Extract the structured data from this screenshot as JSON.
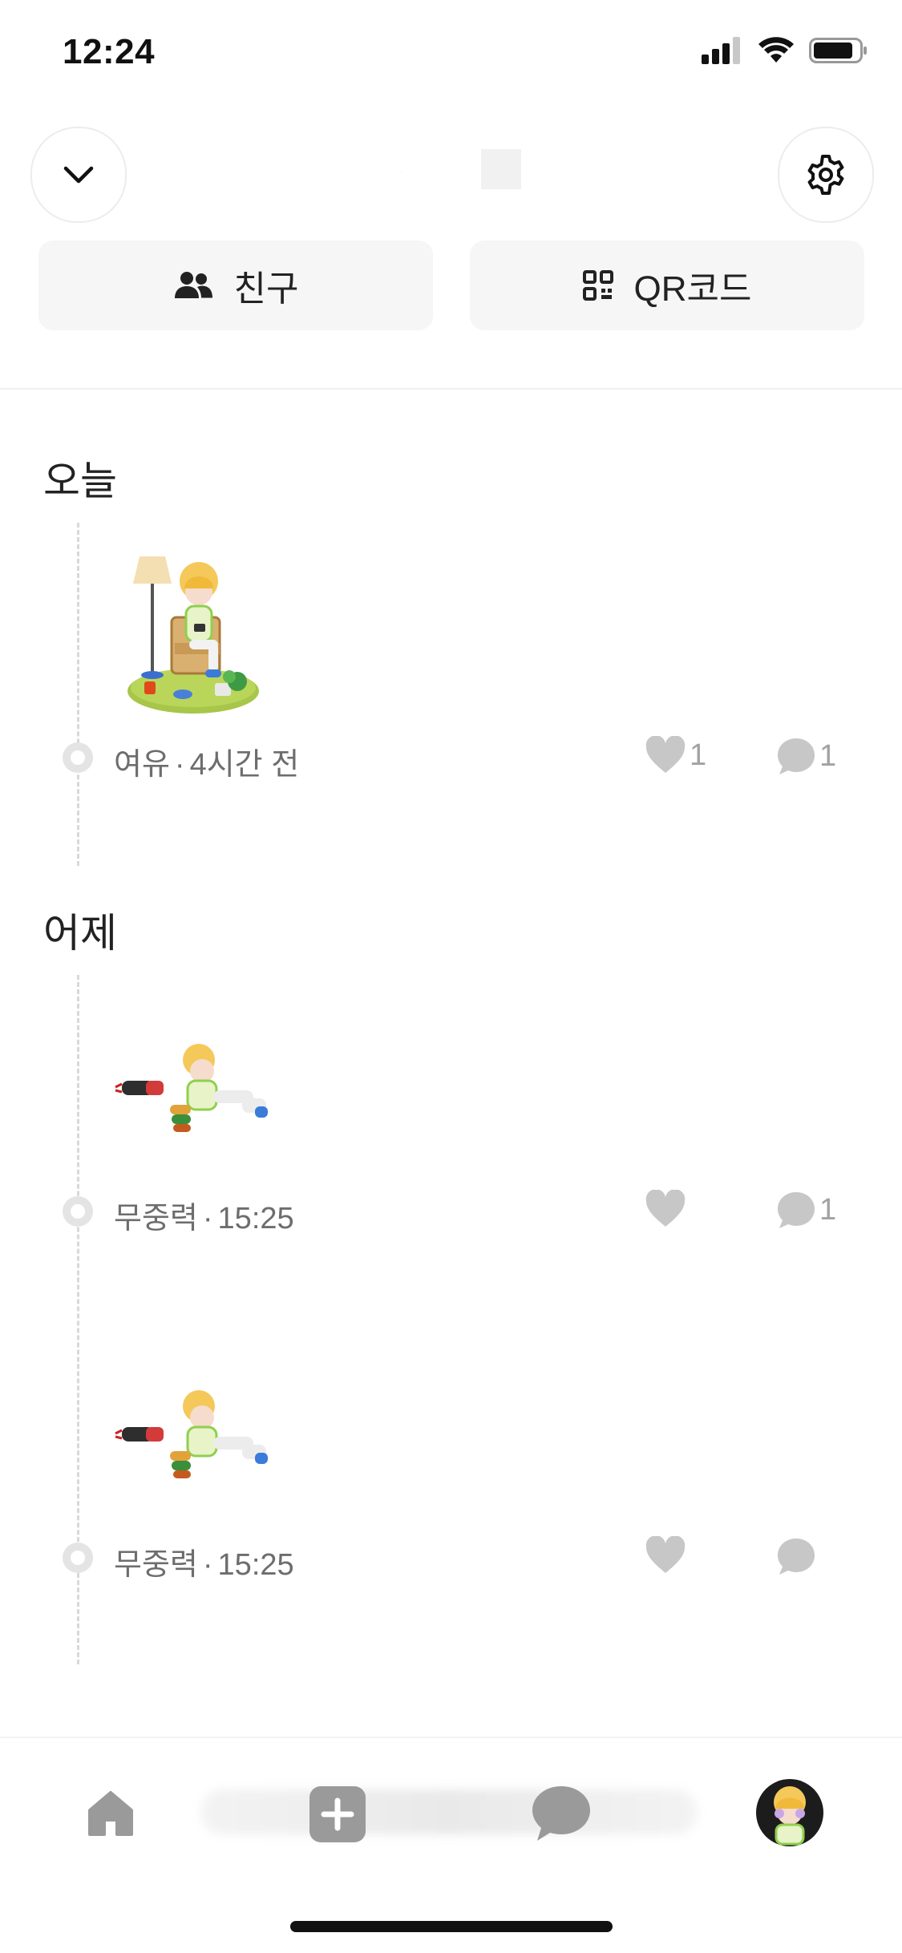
{
  "status_bar": {
    "time": "12:24"
  },
  "header": {
    "title": "."
  },
  "tabs": [
    {
      "label": "친구",
      "icon": "people-icon"
    },
    {
      "label": "QR코드",
      "icon": "qr-code-icon"
    }
  ],
  "sections": [
    {
      "heading": "오늘",
      "posts": [
        {
          "mood": "여유",
          "time": "4시간 전",
          "likes": "1",
          "comments": "1",
          "image": "avatar-reading-chair-lamp"
        }
      ]
    },
    {
      "heading": "어제",
      "posts": [
        {
          "mood": "무중력",
          "time": "15:25",
          "likes": "",
          "comments": "1",
          "image": "avatar-floating-zero-gravity"
        },
        {
          "mood": "무중력",
          "time": "15:25",
          "likes": "",
          "comments": "",
          "image": "avatar-floating-zero-gravity"
        }
      ]
    }
  ],
  "meta_separator": "·",
  "bottom_nav": {
    "items": [
      "home-icon",
      "add-icon",
      "chat-icon",
      "profile-avatar"
    ]
  }
}
